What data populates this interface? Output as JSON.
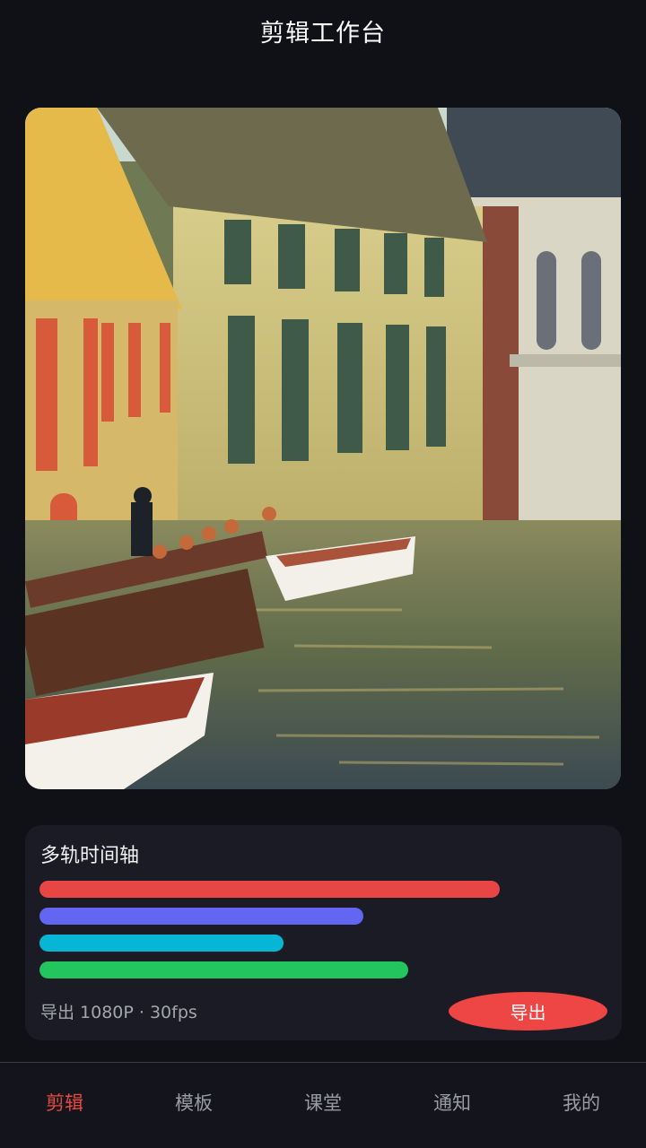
{
  "header": {
    "title": "剪辑工作台"
  },
  "preview": {
    "description_icon": "canal-photo"
  },
  "timeline": {
    "title": "多轨时间轴",
    "tracks": [
      {
        "color": "#e84545",
        "length_fraction": 0.81
      },
      {
        "color": "#6366f1",
        "length_fraction": 0.57
      },
      {
        "color": "#06b6d4",
        "length_fraction": 0.43
      },
      {
        "color": "#22c55e",
        "length_fraction": 0.65
      }
    ],
    "export_info": "导出 1080P · 30fps",
    "export_label": "导出"
  },
  "tabbar": {
    "tabs": [
      {
        "label": "剪辑",
        "active": true
      },
      {
        "label": "模板",
        "active": false
      },
      {
        "label": "课堂",
        "active": false
      },
      {
        "label": "通知",
        "active": false
      },
      {
        "label": "我的",
        "active": false
      }
    ]
  },
  "colors": {
    "accent": "#e9493f",
    "background": "#0f1117",
    "card": "#1a1b24"
  }
}
